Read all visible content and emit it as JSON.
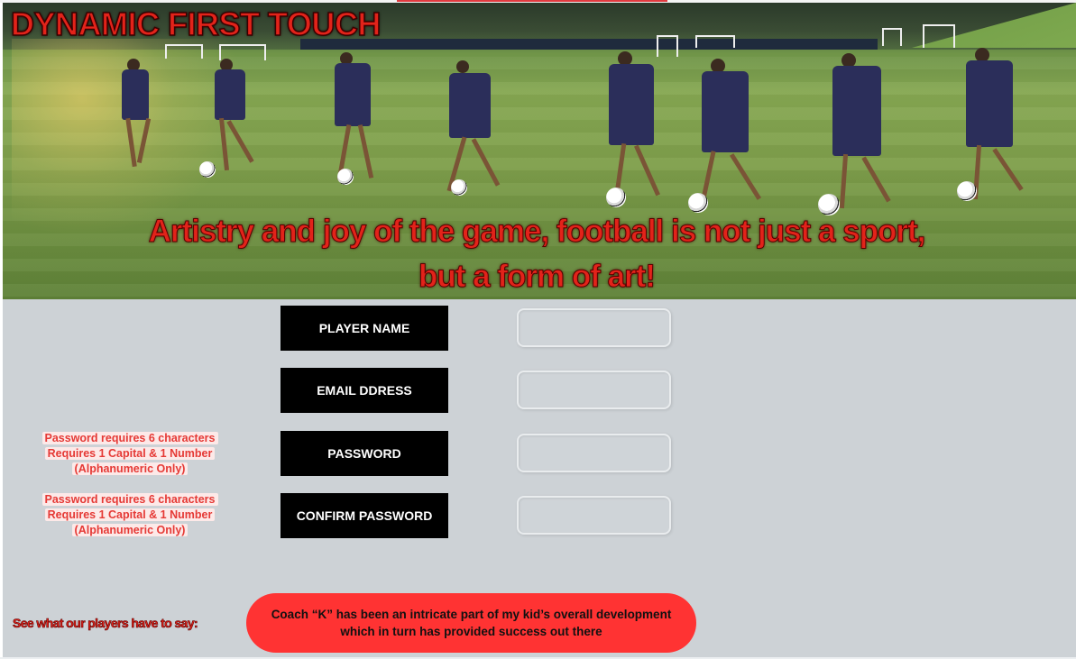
{
  "hero": {
    "title": "DYNAMIC FIRST TOUCH",
    "tagline_line1": "Artistry and joy of the game, football is not just a sport,",
    "tagline_line2": "but a form of art!"
  },
  "form": {
    "fields": [
      {
        "label": "PLAYER NAME",
        "value": ""
      },
      {
        "label": "EMAIL DDRESS",
        "value": ""
      },
      {
        "label": "PASSWORD",
        "value": ""
      },
      {
        "label": "CONFIRM PASSWORD",
        "value": ""
      }
    ],
    "password_hint": {
      "line1": "Password requires 6 characters",
      "line2": "Requires 1 Capital & 1 Number",
      "line3": "(Alphanumeric Only)"
    },
    "confirm_hint": {
      "line1": "Password requires 6 characters",
      "line2": "Requires 1 Capital & 1 Number",
      "line3": "(Alphanumeric Only)"
    }
  },
  "testimonials": {
    "heading": "See what our players have to say:",
    "quote_line1": "Coach “K” has been an intricate part of my kid’s overall development",
    "quote_line2": "which in turn has provided success out there"
  },
  "colors": {
    "accent_red": "#e2231a",
    "label_bg": "#000000",
    "form_bg": "#cdd2d6",
    "testimonial_bg": "#ff3333"
  }
}
